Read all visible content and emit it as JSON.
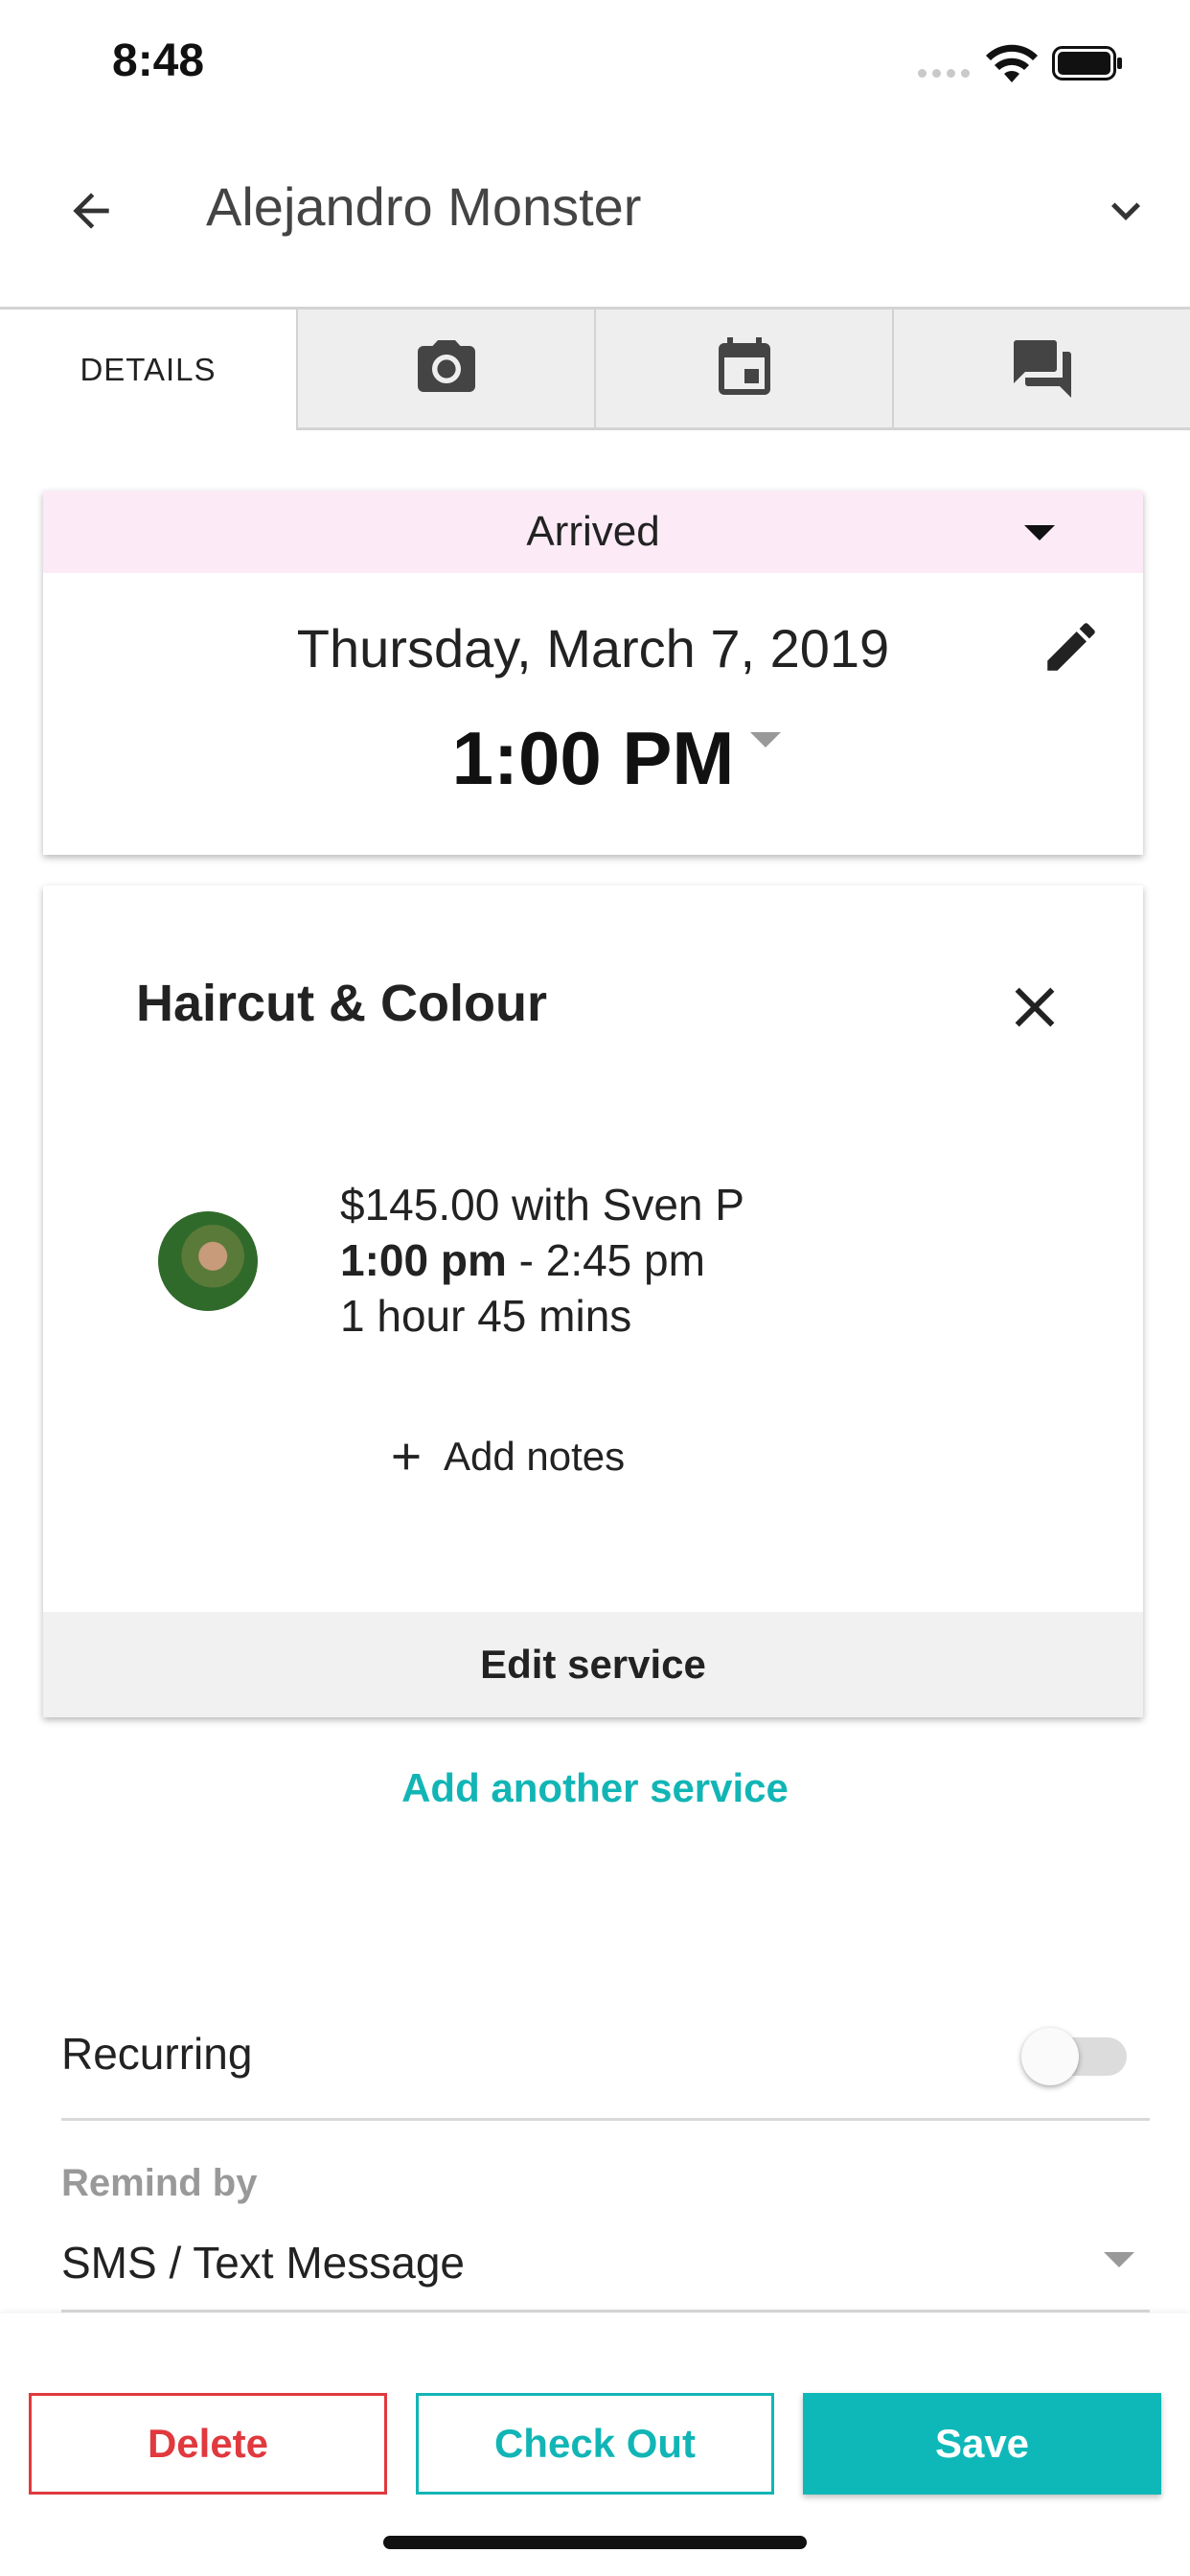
{
  "status_bar": {
    "time": "8:48"
  },
  "header": {
    "title": "Alejandro Monster"
  },
  "tabs": [
    {
      "label": "DETAILS",
      "icon": ""
    },
    {
      "label": "",
      "icon": "camera-icon"
    },
    {
      "label": "",
      "icon": "calendar-icon"
    },
    {
      "label": "",
      "icon": "chat-icon"
    }
  ],
  "appointment": {
    "status": "Arrived",
    "date": "Thursday, March 7, 2019",
    "time": "1:00 PM"
  },
  "service": {
    "title": "Haircut & Colour",
    "price_line": "$145.00 with Sven P",
    "start_time": "1:00 pm",
    "end_time_suffix": " - 2:45 pm",
    "duration": "1 hour 45 mins",
    "add_notes": "Add notes",
    "edit_label": "Edit service"
  },
  "add_another_service": "Add another service",
  "recurring": {
    "label": "Recurring",
    "enabled": false
  },
  "remind": {
    "label": "Remind by",
    "value": "SMS / Text Message"
  },
  "actions": {
    "delete": "Delete",
    "checkout": "Check Out",
    "save": "Save"
  },
  "colors": {
    "accent": "#0fb8b8",
    "danger": "#e0393e",
    "status_bg": "#fcebf7"
  }
}
